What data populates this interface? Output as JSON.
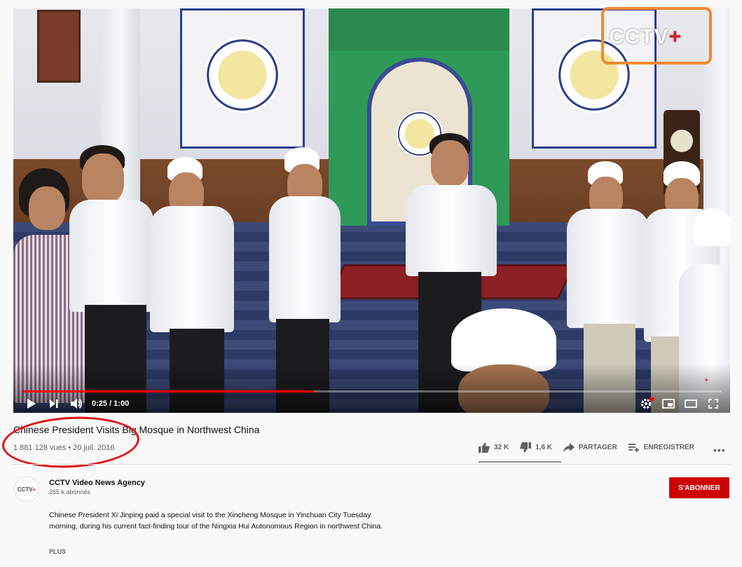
{
  "video": {
    "watermark": "CCTV",
    "watermark_plus": "+",
    "time_display": "0:25 / 1:00",
    "progress_fraction": 0.417
  },
  "meta": {
    "title": "Chinese President Visits Big Mosque in Northwest China",
    "views_date": "1 881 128 vues • 20 juil. 2016",
    "likes": "32 K",
    "dislikes": "1,6 K",
    "share_label": "PARTAGER",
    "save_label": "ENREGISTRER",
    "more": "•••"
  },
  "channel": {
    "avatar_text": "CCTV",
    "avatar_plus": "+",
    "name": "CCTV Video News Agency",
    "subscribers": "265 k abonnés",
    "subscribe_label": "S'ABONNER",
    "description": "Chinese President Xi Jinping paid a special visit to the Xincheng Mosque in Yinchuan City Tuesday morning, during his current fact-finding tour of the Ningxia Hui Autonomous Region in northwest China.",
    "show_more": "PLUS"
  },
  "colors": {
    "annotation_rect": "#f08a30",
    "annotation_ellipse": "#e01010",
    "subscribe": "#cc0000",
    "progress": "#ff0000"
  },
  "icons": [
    "play-icon",
    "next-icon",
    "volume-icon",
    "settings-icon",
    "miniplayer-icon",
    "theater-icon",
    "fullscreen-icon",
    "like-icon",
    "dislike-icon",
    "share-icon",
    "save-icon"
  ]
}
